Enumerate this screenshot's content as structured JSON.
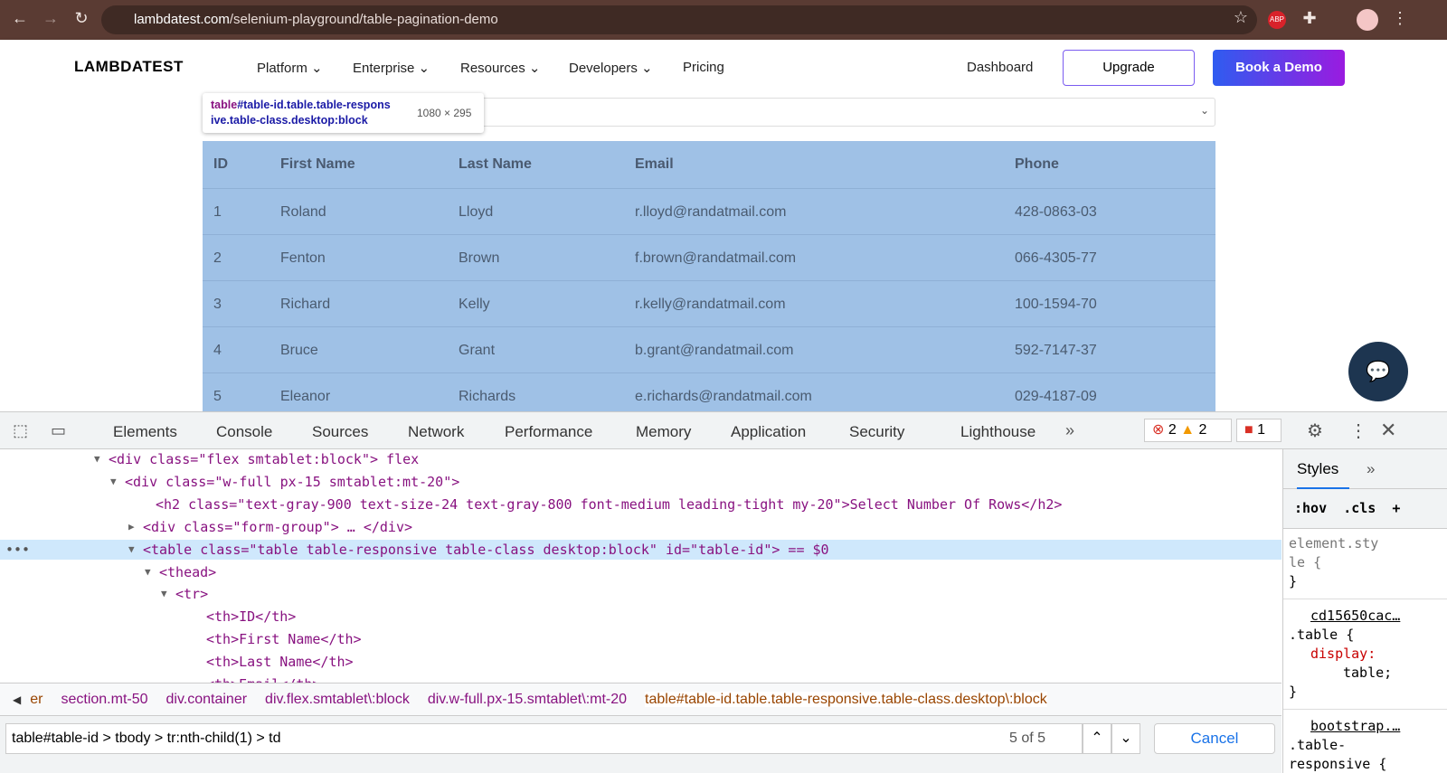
{
  "browser": {
    "url_host": "lambdatest.com",
    "url_path": "/selenium-playground/table-pagination-demo"
  },
  "nav": {
    "logo": "LAMBDATEST",
    "items": [
      "Platform",
      "Enterprise",
      "Resources",
      "Developers",
      "Pricing"
    ],
    "dashboard": "Dashboard",
    "upgrade": "Upgrade",
    "book_demo": "Book a Demo"
  },
  "tooltip": {
    "tag": "table",
    "selector1": "#table-id.table.table-respons",
    "selector2": "ive.table-class.desktop:block",
    "size": "1080 × 295"
  },
  "table": {
    "headers": [
      "ID",
      "First Name",
      "Last Name",
      "Email",
      "Phone"
    ],
    "rows": [
      [
        "1",
        "Roland",
        "Lloyd",
        "r.lloyd@randatmail.com",
        "428-0863-03"
      ],
      [
        "2",
        "Fenton",
        "Brown",
        "f.brown@randatmail.com",
        "066-4305-77"
      ],
      [
        "3",
        "Richard",
        "Kelly",
        "r.kelly@randatmail.com",
        "100-1594-70"
      ],
      [
        "4",
        "Bruce",
        "Grant",
        "b.grant@randatmail.com",
        "592-7147-37"
      ],
      [
        "5",
        "Eleanor",
        "Richards",
        "e.richards@randatmail.com",
        "029-4187-09"
      ]
    ]
  },
  "devtools": {
    "tabs": [
      "Elements",
      "Console",
      "Sources",
      "Network",
      "Performance",
      "Memory",
      "Application",
      "Security",
      "Lighthouse"
    ],
    "errors": "2",
    "warnings": "2",
    "issues": "1",
    "code": [
      "<div class=\"flex smtablet:block\"> flex",
      "<div class=\"w-full px-15 smtablet:mt-20\">",
      "<h2 class=\"text-gray-900 text-size-24 text-gray-800 font-medium leading-tight my-20\">Select Number Of Rows</h2>",
      "<div class=\"form-group\"> … </div>",
      "<table class=\"table table-responsive table-class desktop:block\" id=\"table-id\"> == $0",
      "<thead>",
      "<tr>",
      "<th>ID</th>",
      "<th>First Name</th>",
      "<th>Last Name</th>",
      "<th>Email</th>"
    ],
    "styles": {
      "tab": "Styles",
      "hov": ":hov",
      "cls": ".cls",
      "lines": [
        "element.sty",
        "le {",
        "}",
        "cd15650cac…",
        ".table {",
        "display:",
        "table;",
        "}",
        "bootstrap.…",
        ".table-",
        "responsive {"
      ]
    },
    "breadcrumbs": [
      "er",
      "section.mt-50",
      "div.container",
      "div.flex.smtablet\\:block",
      "div.w-full.px-15.smtablet\\:mt-20",
      "table#table-id.table.table-responsive.table-class.desktop\\:block"
    ],
    "search": {
      "query": "table#table-id > tbody > tr:nth-child(1) > td",
      "count": "5 of 5",
      "cancel": "Cancel"
    }
  }
}
